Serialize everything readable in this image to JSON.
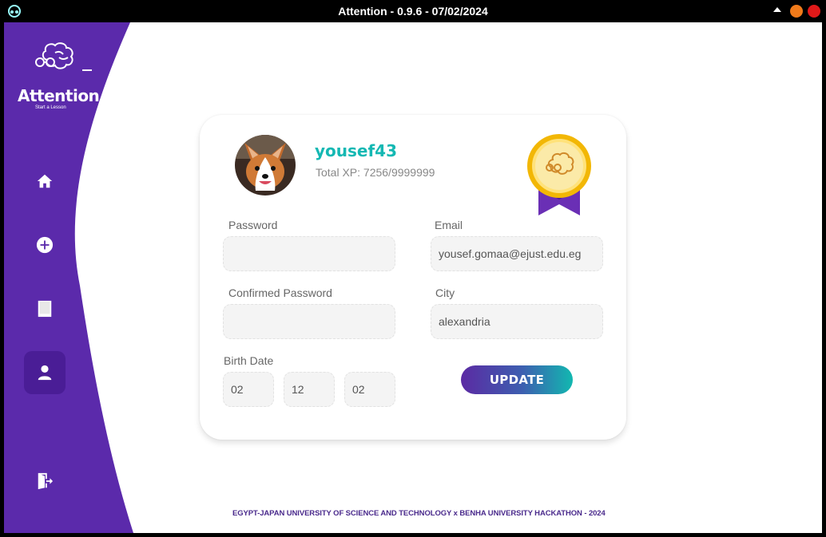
{
  "window": {
    "title": "Attention - 0.9.6 - 07/02/2024"
  },
  "brand": {
    "name": "Attention",
    "tagline": "Start a Lesson",
    "primary_color": "#5b2aab",
    "accent_color": "#14b8b3"
  },
  "sidebar": {
    "items": [
      {
        "icon": "home-icon",
        "active": false
      },
      {
        "icon": "plus-circle-icon",
        "active": false
      },
      {
        "icon": "book-icon",
        "active": false
      },
      {
        "icon": "user-icon",
        "active": true
      },
      {
        "icon": "logout-icon",
        "active": false
      }
    ]
  },
  "profile": {
    "username": "yousef43",
    "xp_label": "Total XP: 7256/9999999",
    "avatar": "corgi-dog-photo",
    "badge_icon": "brain-medal-icon"
  },
  "form": {
    "password_label": "Password",
    "password_value": "",
    "confirm_label": "Confirmed Password",
    "confirm_value": "",
    "email_label": "Email",
    "email_value": "yousef.gomaa@ejust.edu.eg",
    "city_label": "City",
    "city_value": "alexandria",
    "birth_label": "Birth Date",
    "birth_day": "02",
    "birth_month": "12",
    "birth_year": "02",
    "update_label": "UPDATE"
  },
  "footer": {
    "text": "EGYPT-JAPAN UNIVERSITY OF SCIENCE AND TECHNOLOGY x BENHA UNIVERSITY HACKATHON - 2024"
  }
}
